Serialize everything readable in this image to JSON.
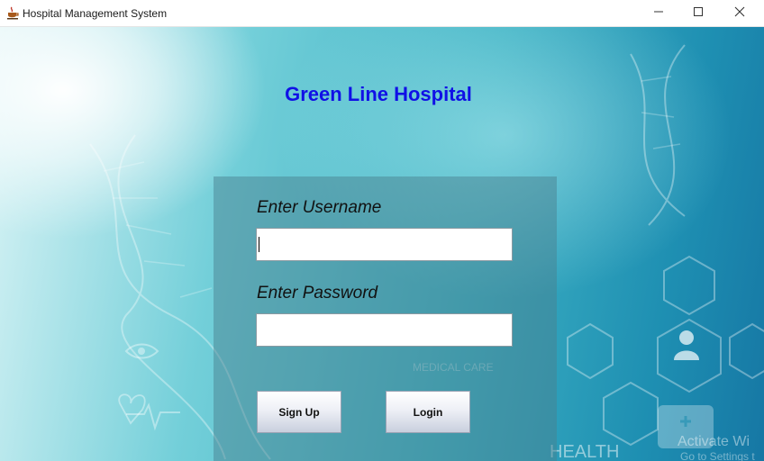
{
  "window": {
    "title": "Hospital Management System",
    "icon": "java-coffee-cup-icon",
    "controls": [
      "minimize-icon",
      "maximize-icon",
      "close-icon"
    ]
  },
  "header": {
    "title": "Green Line Hospital"
  },
  "login_form": {
    "username_label": "Enter Username",
    "username_value": "",
    "password_label": "Enter Password",
    "password_value": "",
    "signup_label": "Sign Up",
    "login_label": "Login"
  },
  "background": {
    "texts": {
      "medical_care": "MEDICAL CARE",
      "health": "HEALTH",
      "watermark_1": "Activate Wi",
      "watermark_2": "Go to Settings t"
    }
  },
  "colors": {
    "title": "#1010e6",
    "panel": "#4a808e",
    "background_accent": "#3fb2c4"
  }
}
